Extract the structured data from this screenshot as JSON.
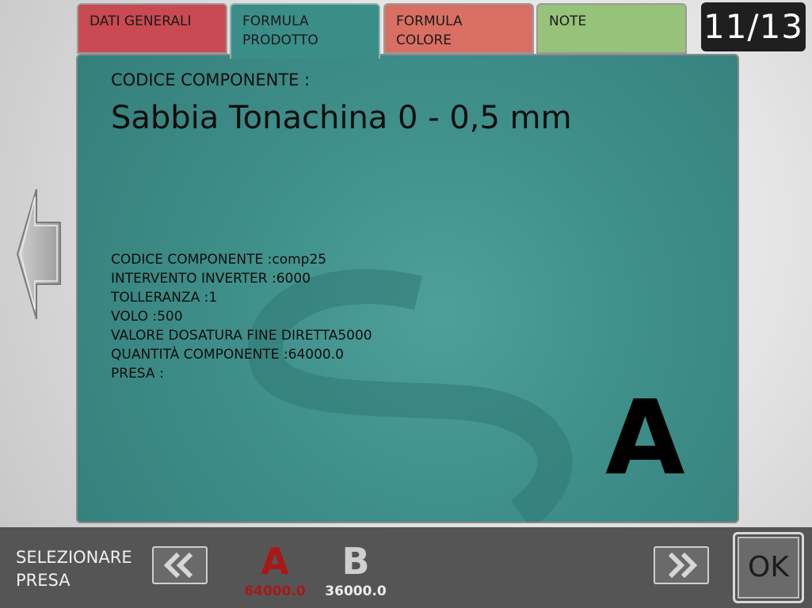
{
  "tabs": [
    {
      "label": "DATI GENERALI"
    },
    {
      "label_line1": "FORMULA",
      "label_line2": "PRODOTTO"
    },
    {
      "label_line1": "FORMULA",
      "label_line2": "COLORE"
    },
    {
      "label": "NOTE"
    }
  ],
  "page_counter": "11/13",
  "main": {
    "component_label": "CODICE COMPONENTE :",
    "component_name": "Sabbia Tonachina 0 - 0,5 mm",
    "details": [
      "CODICE COMPONENTE :comp25",
      "INTERVENTO INVERTER :6000",
      "TOLLERANZA :1",
      "VOLO :500",
      "VALORE DOSATURA FINE DIRETTA5000",
      "QUANTITÀ COMPONENTE :64000.0",
      "PRESA :"
    ],
    "current_presa": "A"
  },
  "bottom": {
    "select_label_line1": "SELEZIONARE",
    "select_label_line2": "PRESA",
    "presa": [
      {
        "letter": "A",
        "quantity": "64000.0",
        "color": "#a81818"
      },
      {
        "letter": "B",
        "quantity": "36000.0",
        "color": "#cfcfcf"
      }
    ],
    "ok_label": "OK"
  },
  "colors": {
    "panel": "#3f8f8a",
    "tab_dati": "#c94a52",
    "tab_colore": "#d96f63",
    "tab_note": "#97c27a",
    "bottom_bar": "#555555"
  },
  "icons": [
    "arrow-left-icon",
    "double-chevron-left-icon",
    "double-chevron-right-icon"
  ]
}
